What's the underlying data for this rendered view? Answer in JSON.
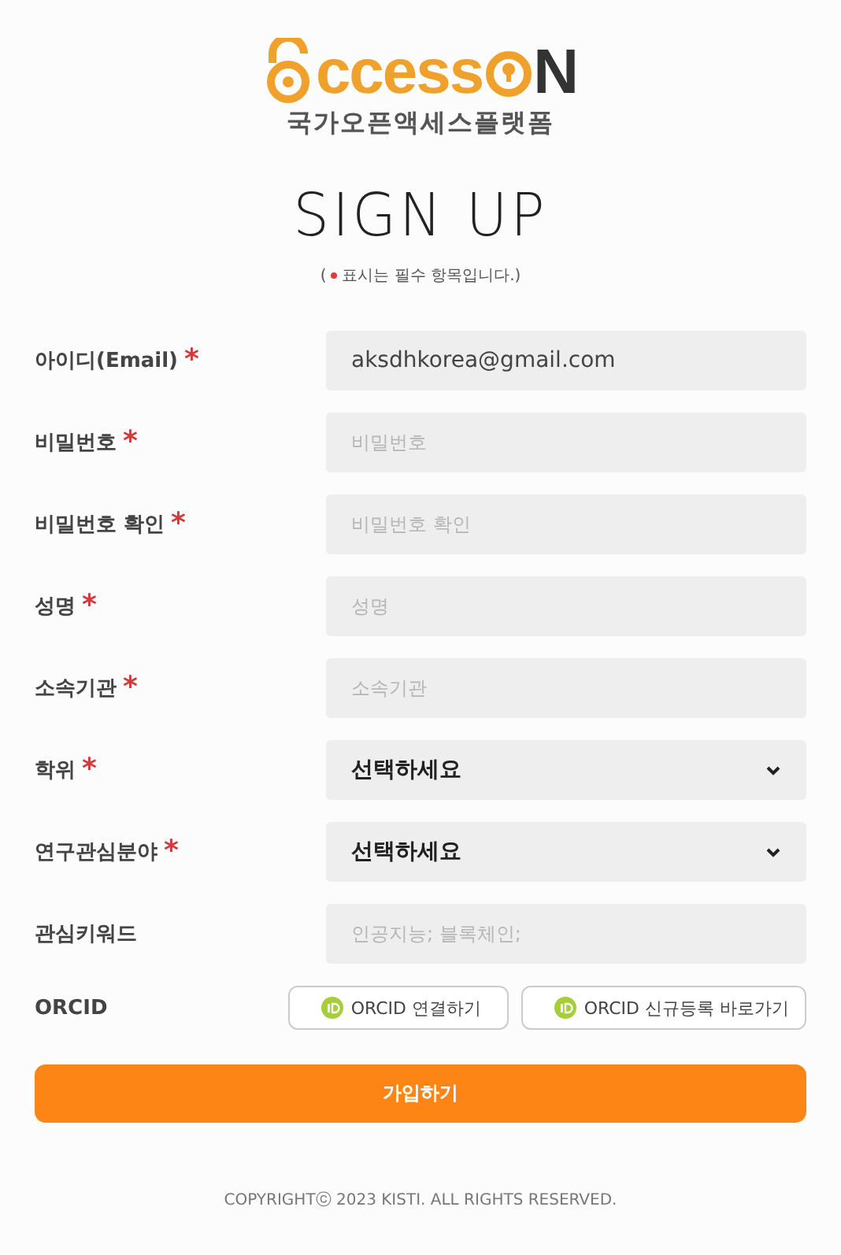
{
  "logo": {
    "text_a": "ccess",
    "text_b": "N",
    "subtitle": "국가오픈액세스플랫폼"
  },
  "title": "SIGN UP",
  "notice": {
    "open": "(",
    "text": "표시는 필수 항목입니다.)"
  },
  "fields": [
    {
      "label": "아이디(Email)",
      "required_mark": "*",
      "kind": "text",
      "value": "aksdhkorea@gmail.com"
    },
    {
      "label": "비밀번호",
      "required_mark": "*",
      "kind": "text",
      "placeholder": "비밀번호"
    },
    {
      "label": "비밀번호 확인",
      "required_mark": "*",
      "kind": "text",
      "placeholder": "비밀번호 확인"
    },
    {
      "label": "성명",
      "required_mark": "*",
      "kind": "text",
      "placeholder": "성명"
    },
    {
      "label": "소속기관",
      "required_mark": "*",
      "kind": "text",
      "placeholder": "소속기관"
    },
    {
      "label": "학위",
      "required_mark": "*",
      "kind": "select",
      "value": "선택하세요"
    },
    {
      "label": "연구관심분야",
      "required_mark": "*",
      "kind": "select",
      "value": "선택하세요"
    },
    {
      "label": "관심키워드",
      "kind": "text",
      "placeholder": "인공지능; 블록체인;"
    }
  ],
  "orcid": {
    "label": "ORCID",
    "buttons": [
      "ORCID 연결하기",
      "ORCID 신규등록 바로가기"
    ]
  },
  "submit": "가입하기",
  "copyright": "COPYRIGHTⓒ 2023 KISTI. ALL RIGHTS RESERVED."
}
